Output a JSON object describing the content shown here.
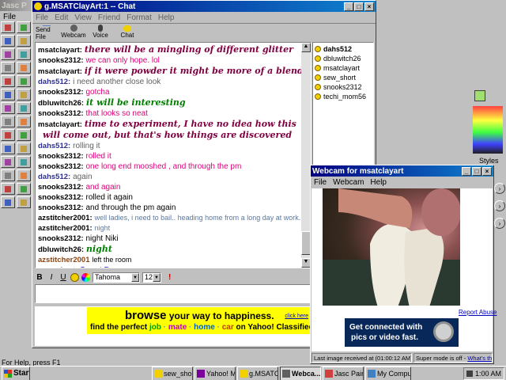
{
  "paint": {
    "title": "Jasc P",
    "styles_label": "Styles",
    "status": "For Help, press F1",
    "menu": [
      "File",
      "Edit"
    ]
  },
  "chat": {
    "title": "g.MSATClayArt:1 -- Chat",
    "menu": [
      "File",
      "Edit",
      "View",
      "Friend",
      "Format",
      "Help"
    ],
    "toolbar": [
      {
        "label": "Send File",
        "icon": "send-file-icon"
      },
      {
        "label": "Webcam",
        "icon": "webcam-icon"
      },
      {
        "label": "Voice",
        "icon": "voice-icon"
      },
      {
        "label": "Chat",
        "icon": "chat-icon"
      }
    ],
    "messages": [
      {
        "nick": "msatclayart:",
        "text": "there will be a mingling of different glitter",
        "color": "#800040",
        "style": "script"
      },
      {
        "nick": "snooks2312:",
        "text": "we can only hope. lol",
        "color": "#e0007a",
        "style": "normal"
      },
      {
        "nick": "msatclayart:",
        "text": "if it were powder it might be more of a blend",
        "color": "#800040",
        "style": "script"
      },
      {
        "nick": "dahs512:",
        "text": "i need another close look",
        "color": "#606060",
        "style": "normal"
      },
      {
        "nick": "snooks2312:",
        "text": "gotcha",
        "color": "#e0007a",
        "style": "normal"
      },
      {
        "nick": "dbluwitch26:",
        "text": "it will be interesting",
        "color": "#008000",
        "style": "script"
      },
      {
        "nick": "snooks2312:",
        "text": "that looks so neat",
        "color": "#e0007a",
        "style": "normal"
      },
      {
        "nick": "msatclayart:",
        "text": "time to experiment, I have no idea how this",
        "color": "#800040",
        "style": "script"
      },
      {
        "nick": "",
        "text": "will come out, but that's how things are discovered",
        "color": "#800040",
        "style": "script"
      },
      {
        "nick": "dahs512:",
        "text": "rolling it",
        "color": "#606060",
        "style": "normal"
      },
      {
        "nick": "snooks2312:",
        "text": "rolled it",
        "color": "#e0007a",
        "style": "normal"
      },
      {
        "nick": "snooks2312:",
        "text": "one long end mooshed , and through the pm",
        "color": "#e0007a",
        "style": "normal"
      },
      {
        "nick": "dahs512:",
        "text": "again",
        "color": "#606060",
        "style": "normal"
      },
      {
        "nick": "snooks2312:",
        "text": "and again",
        "color": "#e0007a",
        "style": "normal"
      },
      {
        "nick": "snooks2312:",
        "text": "rolled it again",
        "color": "#000000",
        "style": "normal"
      },
      {
        "nick": "snooks2312:",
        "text": "and through the pm again",
        "color": "#000000",
        "style": "normal"
      },
      {
        "nick": "azstitcher2001:",
        "text": "well ladies, i need to bail.. heading home from a long day at work.",
        "color": "#5a78a0",
        "style": "small"
      },
      {
        "nick": "azstitcher2001:",
        "text": "night",
        "color": "#5a78a0",
        "style": "small"
      },
      {
        "nick": "snooks2312:",
        "text": "night Niki",
        "color": "#000000",
        "style": "normal"
      },
      {
        "nick": "dbluwitch26:",
        "text": "night",
        "color": "#008000",
        "style": "script"
      },
      {
        "nick": "azstitcher2001",
        "text": "left the room",
        "color": "#000000",
        "style": "system"
      },
      {
        "nick": "sew_short:",
        "text": "Sweet Dreams",
        "color": "#0000c0",
        "style": "normal"
      }
    ],
    "buddies": [
      "dahs512",
      "dbluwitch26",
      "msatclayart",
      "sew_short",
      "snooks2312",
      "techi_mom56"
    ],
    "format": {
      "bold": "B",
      "italic": "I",
      "underline": "U",
      "font": "Tahoma",
      "size": "12"
    },
    "ad": {
      "headline_a": "browse",
      "headline_b": " your way to happiness.",
      "click": "click here",
      "line_pre": "find the perfect ",
      "job": "job",
      "mate": "mate",
      "home": "home",
      "car": "car",
      "line_post": " on Yahoo! Classified",
      "sep": " · "
    }
  },
  "webcam": {
    "title": "Webcam for msatclayart",
    "menu": [
      "File",
      "Webcam",
      "Help"
    ],
    "report": "Report Abuse",
    "ad_line1": "Get connected with",
    "ad_line2": "pics or video fast.",
    "status_left": "Last image received at (01:00:12 AM)",
    "status_right_pre": "Super mode is off - ",
    "status_right_link": "What's this?"
  },
  "taskbar": {
    "start": "Start",
    "tasks": [
      {
        "label": "sew_short'...",
        "icon": "chat-icon"
      },
      {
        "label": "Yahoo! Me...",
        "icon": "yahoo-icon"
      },
      {
        "label": "g.MSATCL...",
        "icon": "chat-icon"
      },
      {
        "label": "Webca...",
        "icon": "webcam-icon"
      },
      {
        "label": "Jasc Paint ...",
        "icon": "paint-icon"
      },
      {
        "label": "My Computer",
        "icon": "computer-icon"
      }
    ],
    "clock": "1:00 AM"
  }
}
